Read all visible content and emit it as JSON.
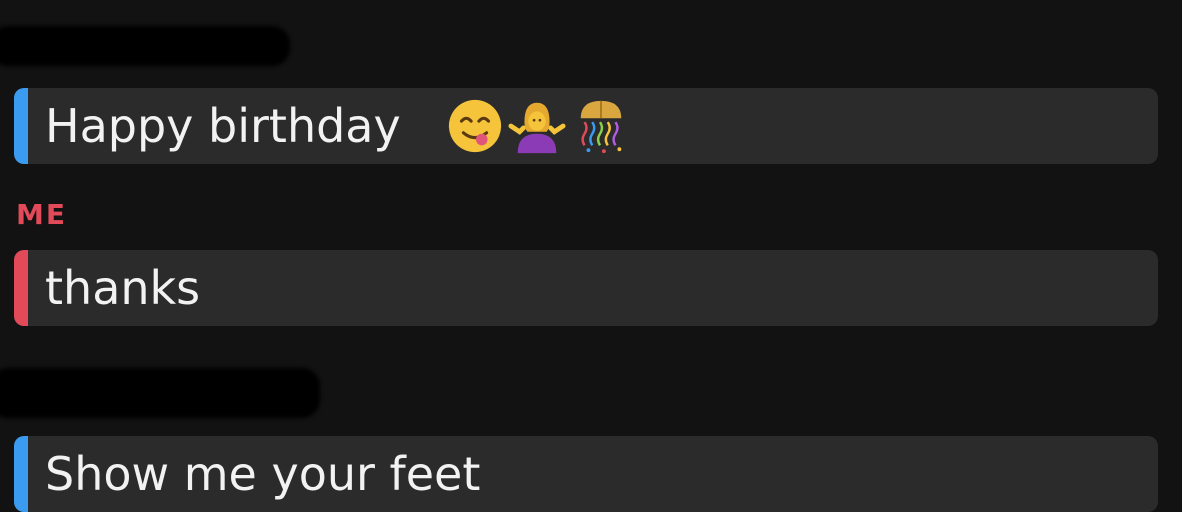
{
  "colors": {
    "background": "#121212",
    "bubble": "#2b2b2b",
    "friend_accent": "#3a9bf0",
    "me_accent": "#e24a5a"
  },
  "messages": [
    {
      "sender": "friend",
      "text": "Happy birthday",
      "emojis": [
        "yum-face-emoji",
        "woman-shrugging-emoji",
        "confetti-ball-emoji"
      ]
    },
    {
      "sender_label": "ME",
      "sender": "me",
      "text": "thanks"
    },
    {
      "sender": "friend",
      "text": "Show me your feet"
    }
  ]
}
